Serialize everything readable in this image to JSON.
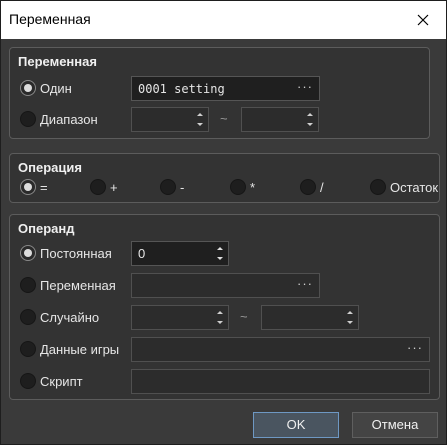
{
  "window": {
    "title": "Переменная"
  },
  "variable_group": {
    "title": "Переменная",
    "single_label": "Один",
    "single_value": "0001 setting",
    "range_label": "Диапазон",
    "range_sep": "~"
  },
  "operation_group": {
    "title": "Операция",
    "options": [
      "=",
      "+",
      "-",
      "*",
      "/",
      "Остаток"
    ],
    "selected": "="
  },
  "operand_group": {
    "title": "Операнд",
    "constant_label": "Постоянная",
    "constant_value": "0",
    "variable_label": "Переменная",
    "random_label": "Случайно",
    "random_sep": "~",
    "gamedata_label": "Данные игры",
    "script_label": "Скрипт"
  },
  "buttons": {
    "ok": "OK",
    "cancel": "Отмена"
  },
  "icons": {
    "close": "close-icon",
    "ellipsis": "ellipsis-icon",
    "spin": "spin-arrows-icon"
  },
  "colors": {
    "accent": "#6e98c3",
    "background": "#3a3a3a"
  }
}
